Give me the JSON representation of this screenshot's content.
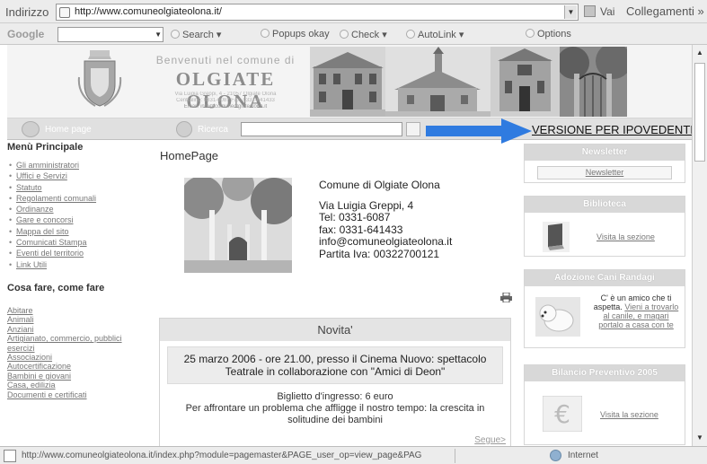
{
  "browser": {
    "address_label": "Indirizzo",
    "url": "http://www.comuneolgiateolona.it/",
    "go_label": "Vai",
    "links_label": "Collegamenti »",
    "google": {
      "logo": "Google",
      "search_label": "Search",
      "popups_label": "Popups okay",
      "check_label": "Check",
      "autolink_label": "AutoLink",
      "options_label": "Options"
    },
    "status_url": "http://www.comuneolgiateolona.it/index.php?module=pagemaster&PAGE_user_op=view_page&PAG",
    "status_zone": "Internet"
  },
  "header": {
    "welcome": "Benvenuti nel comune di",
    "town": "OLGIATE OLONA",
    "address_line1": "Via Luigia Greppi, 4 - 21057 Olgiate Olona",
    "address_line2": "Centralino: 0331-6087 Fax: 0331-641433",
    "address_line3": "Email: info@comuneolgiateolona.it"
  },
  "nav": {
    "home_label": "Home page",
    "search_label": "Ricerca",
    "ipovedenti_label": "VERSIONE PER IPOVEDENTI"
  },
  "left": {
    "menu_title": "Menù Principale",
    "menu_items": [
      "Gli amministratori",
      "Uffici e Servizi",
      "Statuto",
      "Regolamenti comunali",
      "Ordinanze",
      "Gare e concorsi",
      "Mappa del sito",
      "Comunicati Stampa",
      "Eventi del territorio",
      "Link Utili"
    ],
    "cosa_title": "Cosa fare, come fare",
    "cosa_items": [
      "Abitare",
      "Animali",
      "Anziani",
      "Artigianato, commercio, pubblici esercizi",
      "Associazioni",
      "Autocertificazione",
      "Bambini e giovani",
      "Casa, edilizia",
      "Documenti e certificati"
    ]
  },
  "center": {
    "page_title": "HomePage",
    "contact": {
      "name": "Comune di Olgiate Olona",
      "street": "Via Luigia Greppi, 4",
      "tel": "Tel: 0331-6087",
      "fax": "fax: 0331-641433",
      "email": "info@comuneolgiateolona.it",
      "vat": "Partita Iva: 00322700121"
    },
    "novita": {
      "title": "Novita'",
      "headline": "25 marzo 2006 - ore 21.00, presso il Cinema Nuovo: spettacolo Teatrale in collaborazione con \"Amici di Deon\"",
      "ticket": "Biglietto d'ingresso: 6 euro",
      "description": "Per affrontare un problema che affligge il nostro tempo: la crescita in solitudine dei bambini",
      "more": "Segue>"
    }
  },
  "right": {
    "newsletter": {
      "title": "Newsletter",
      "link": "Newsletter"
    },
    "biblioteca": {
      "title": "Biblioteca",
      "link": "Visita la sezione"
    },
    "cani": {
      "title": "Adozione Cani Randagi",
      "text_pre": "C' è un amico che ti aspetta.",
      "text_link": "Vieni a trovarlo al canile, e magari portalo a casa con te"
    },
    "bilancio": {
      "title": "Bilancio Preventivo 2005",
      "link": "Visita la sezione"
    }
  },
  "colors": {
    "arrow": "#2f7be0",
    "chrome": "#ececec",
    "box_header": "#d8d8d8"
  }
}
